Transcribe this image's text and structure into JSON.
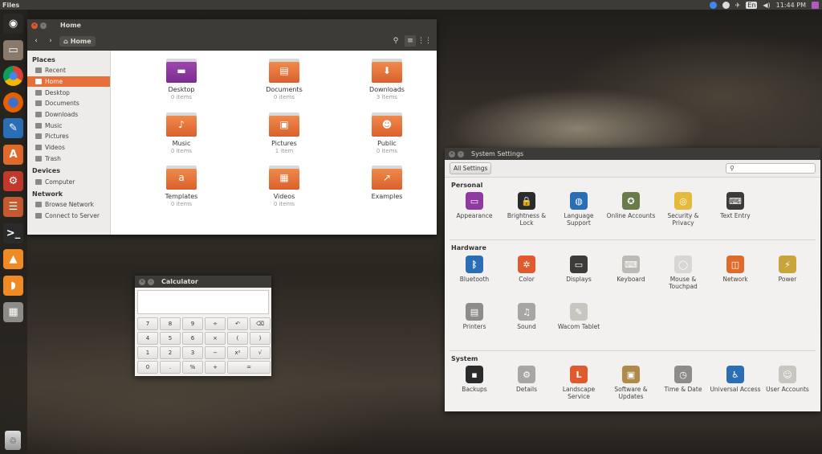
{
  "toppanel": {
    "app_name": "Files",
    "keyboard": "En",
    "clock": "11:44 PM"
  },
  "launcher": {
    "items": [
      {
        "name": "ubuntu-logo-icon",
        "glyph": "◉",
        "bg": "#2b2926"
      },
      {
        "name": "files-app-icon",
        "glyph": "▭",
        "bg": "#8a7a6b"
      },
      {
        "name": "chrome-icon",
        "glyph": "●",
        "bg": "#3c3b37"
      },
      {
        "name": "firefox-icon",
        "glyph": "●",
        "bg": "#3c3b37"
      },
      {
        "name": "libreoffice-writer-icon",
        "glyph": "✎",
        "bg": "#2a6fb5"
      },
      {
        "name": "software-center-icon",
        "glyph": "A",
        "bg": "#e06a2c"
      },
      {
        "name": "system-settings-icon",
        "glyph": "⚙",
        "bg": "#c0392b"
      },
      {
        "name": "mixer-icon",
        "glyph": "☰",
        "bg": "#c55a2e"
      },
      {
        "name": "terminal-icon",
        "glyph": ">_",
        "bg": "#2b2b2b"
      },
      {
        "name": "vlc-icon",
        "glyph": "▲",
        "bg": "#f08a24"
      },
      {
        "name": "orange-app-icon",
        "glyph": "◗",
        "bg": "#f08a24"
      },
      {
        "name": "calculator-icon",
        "glyph": "▦",
        "bg": "#8e8c88"
      }
    ],
    "trash_glyph": "♲"
  },
  "files": {
    "title": "Home",
    "breadcrumb": "Home",
    "sidebar": {
      "places_heading": "Places",
      "places": [
        "Recent",
        "Home",
        "Desktop",
        "Documents",
        "Downloads",
        "Music",
        "Pictures",
        "Videos",
        "Trash"
      ],
      "devices_heading": "Devices",
      "devices": [
        "Computer"
      ],
      "network_heading": "Network",
      "network": [
        "Browse Network",
        "Connect to Server"
      ]
    },
    "items": [
      {
        "name": "Desktop",
        "count": "0 items",
        "emblem": "▬"
      },
      {
        "name": "Documents",
        "count": "0 items",
        "emblem": "▤"
      },
      {
        "name": "Downloads",
        "count": "3 items",
        "emblem": "⬇"
      },
      {
        "name": "Music",
        "count": "0 items",
        "emblem": "♪"
      },
      {
        "name": "Pictures",
        "count": "1 item",
        "emblem": "▣"
      },
      {
        "name": "Public",
        "count": "0 items",
        "emblem": "☻"
      },
      {
        "name": "Templates",
        "count": "0 items",
        "emblem": "a"
      },
      {
        "name": "Videos",
        "count": "0 items",
        "emblem": "▦"
      },
      {
        "name": "Examples",
        "count": "",
        "emblem": "↗"
      }
    ]
  },
  "calculator": {
    "title": "Calculator",
    "display": "",
    "keys": [
      "7",
      "8",
      "9",
      "÷",
      "↶",
      "⌫",
      "4",
      "5",
      "6",
      "×",
      "(",
      ")",
      "1",
      "2",
      "3",
      "−",
      "x²",
      "√",
      "0",
      ".",
      "%",
      "+",
      "="
    ]
  },
  "settings": {
    "title": "System Settings",
    "all_settings": "All Settings",
    "search_placeholder": "",
    "personal_heading": "Personal",
    "personal": [
      {
        "label": "Appearance",
        "color": "#8e3aa0",
        "glyph": "▭"
      },
      {
        "label": "Brightness & Lock",
        "color": "#2b2b2b",
        "glyph": "🔒"
      },
      {
        "label": "Language Support",
        "color": "#2a6fb5",
        "glyph": "◍"
      },
      {
        "label": "Online Accounts",
        "color": "#6a7b4a",
        "glyph": "✪"
      },
      {
        "label": "Security & Privacy",
        "color": "#e5b93a",
        "glyph": "◎"
      },
      {
        "label": "Text Entry",
        "color": "#3c3b37",
        "glyph": "⌨"
      }
    ],
    "hardware_heading": "Hardware",
    "hardware": [
      {
        "label": "Bluetooth",
        "color": "#2a6fb5",
        "glyph": "ᛒ"
      },
      {
        "label": "Color",
        "color": "#e05a30",
        "glyph": "✲"
      },
      {
        "label": "Displays",
        "color": "#3c3b37",
        "glyph": "▭"
      },
      {
        "label": "Keyboard",
        "color": "#bdbab5",
        "glyph": "⌨"
      },
      {
        "label": "Mouse & Touchpad",
        "color": "#d8d6d2",
        "glyph": "◯"
      },
      {
        "label": "Network",
        "color": "#e06a2c",
        "glyph": "◫"
      },
      {
        "label": "Power",
        "color": "#c9a43a",
        "glyph": "⚡"
      },
      {
        "label": "Printers",
        "color": "#8e8c88",
        "glyph": "▤"
      },
      {
        "label": "Sound",
        "color": "#a8a6a2",
        "glyph": "♫"
      },
      {
        "label": "Wacom Tablet",
        "color": "#c9c6c1",
        "glyph": "✎"
      }
    ],
    "system_heading": "System",
    "system": [
      {
        "label": "Backups",
        "color": "#2b2b2b",
        "glyph": "▪"
      },
      {
        "label": "Details",
        "color": "#a8a6a2",
        "glyph": "⚙"
      },
      {
        "label": "Landscape Service",
        "color": "#e05a30",
        "glyph": "L"
      },
      {
        "label": "Software & Updates",
        "color": "#b08a4a",
        "glyph": "▣"
      },
      {
        "label": "Time & Date",
        "color": "#8e8c88",
        "glyph": "◷"
      },
      {
        "label": "Universal Access",
        "color": "#2a6fb5",
        "glyph": "♿"
      },
      {
        "label": "User Accounts",
        "color": "#c9c6c1",
        "glyph": "☺"
      }
    ]
  }
}
